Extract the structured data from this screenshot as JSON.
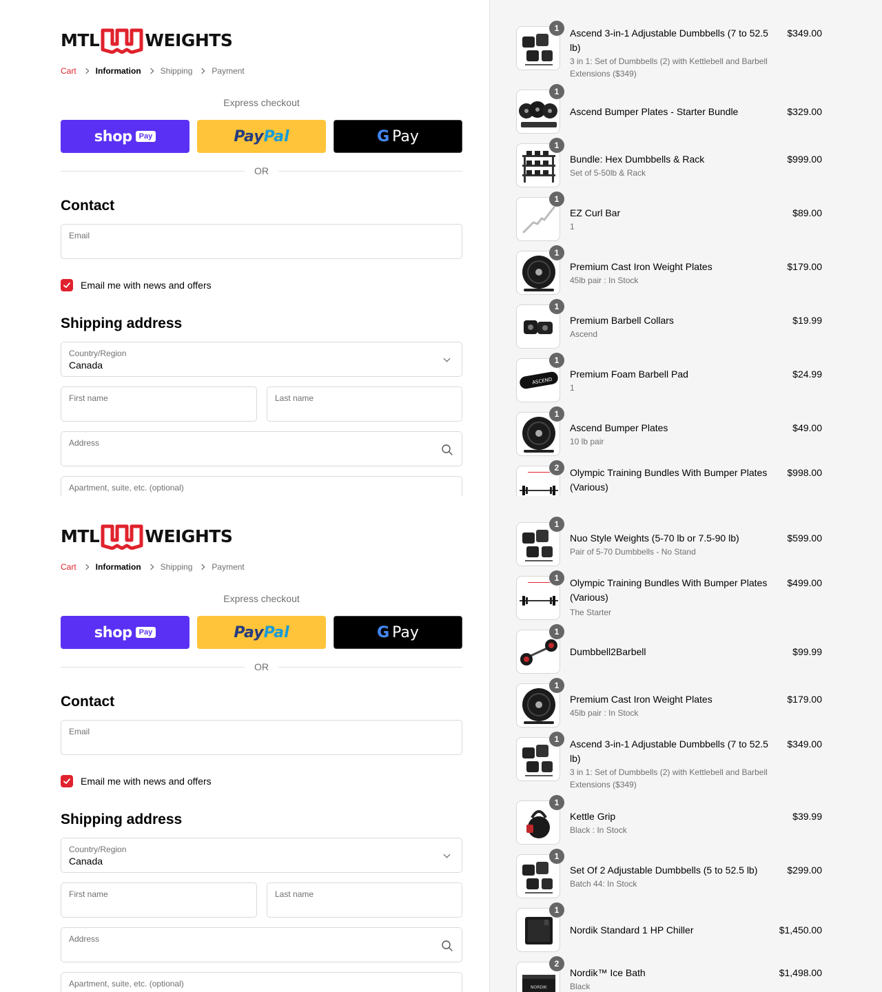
{
  "brand": {
    "logo_left": "MTL",
    "logo_right": "WEIGHTS",
    "accent": "#e0222c"
  },
  "breadcrumb": [
    "Cart",
    "Information",
    "Shipping",
    "Payment"
  ],
  "express": {
    "title": "Express checkout",
    "shop_pay": {
      "word": "shop",
      "badge": "Pay",
      "color": "#5a31f4"
    },
    "paypal": {
      "part1": "Pay",
      "part2": "Pal",
      "color": "#ffc439"
    },
    "gpay": {
      "g": "G",
      "word": "Pay"
    },
    "or": "OR"
  },
  "contact": {
    "title": "Contact",
    "email_label": "Email",
    "newsletter_label": "Email me with news and offers",
    "newsletter_checked": true
  },
  "shipping": {
    "title": "Shipping address",
    "country_label": "Country/Region",
    "country_value": "Canada",
    "first_name_label": "First name",
    "last_name_label": "Last name",
    "address_label": "Address",
    "apartment_label": "Apartment, suite, etc. (optional)"
  },
  "cart_top": [
    {
      "qty": "1",
      "name": "Ascend 3-in-1 Adjustable Dumbbells (7 to 52.5 lb)",
      "variant": "3 in 1: Set of Dumbbells (2) with Kettlebell and Barbell Extensions ($349)",
      "price": "$349.00",
      "icon": "adjustable-dumbbell-icon"
    },
    {
      "qty": "1",
      "name": "Ascend Bumper Plates - Starter Bundle",
      "variant": "",
      "price": "$329.00",
      "icon": "bumper-plates-icon"
    },
    {
      "qty": "1",
      "name": "Bundle: Hex Dumbbells & Rack",
      "variant": "Set of 5-50lb & Rack",
      "price": "$999.00",
      "icon": "dumbbell-rack-icon"
    },
    {
      "qty": "1",
      "name": "EZ Curl Bar",
      "variant": "1",
      "price": "$89.00",
      "icon": "curl-bar-icon"
    },
    {
      "qty": "1",
      "name": "Premium Cast Iron Weight Plates",
      "variant": "45lb pair : In Stock",
      "price": "$179.00",
      "icon": "weight-plate-icon"
    },
    {
      "qty": "1",
      "name": "Premium Barbell Collars",
      "variant": "Ascend",
      "price": "$19.99",
      "icon": "barbell-collar-icon"
    },
    {
      "qty": "1",
      "name": "Premium Foam Barbell Pad",
      "variant": "1",
      "price": "$24.99",
      "icon": "barbell-pad-icon"
    },
    {
      "qty": "1",
      "name": "Ascend Bumper Plates",
      "variant": "10 lb pair",
      "price": "$49.00",
      "icon": "weight-plate-icon"
    },
    {
      "qty": "2",
      "name": "Olympic Training Bundles With Bumper Plates (Various)",
      "variant": "",
      "price": "$998.00",
      "icon": "barbell-bundle-icon"
    }
  ],
  "cart_bottom": [
    {
      "qty": "1",
      "name": "Nuo Style Weights (5-70 lb or 7.5-90 lb)",
      "variant": "Pair of 5-70 Dumbbells - No Stand",
      "price": "$599.00",
      "icon": "adjustable-dumbbell-icon"
    },
    {
      "qty": "1",
      "name": "Olympic Training Bundles With Bumper Plates (Various)",
      "variant": "The Starter",
      "price": "$499.00",
      "icon": "barbell-bundle-icon"
    },
    {
      "qty": "1",
      "name": "Dumbbell2Barbell",
      "variant": "",
      "price": "$99.99",
      "icon": "dumbbell-barbell-icon"
    },
    {
      "qty": "1",
      "name": "Premium Cast Iron Weight Plates",
      "variant": "45lb pair : In Stock",
      "price": "$179.00",
      "icon": "weight-plate-icon"
    },
    {
      "qty": "1",
      "name": "Ascend 3-in-1 Adjustable Dumbbells (7 to 52.5 lb)",
      "variant": "3 in 1: Set of Dumbbells (2) with Kettlebell and Barbell Extensions ($349)",
      "price": "$349.00",
      "icon": "adjustable-dumbbell-icon"
    },
    {
      "qty": "1",
      "name": "Kettle Grip",
      "variant": "Black : In Stock",
      "price": "$39.99",
      "icon": "kettle-grip-icon"
    },
    {
      "qty": "1",
      "name": "Set Of 2 Adjustable Dumbbells (5 to 52.5 lb)",
      "variant": "Batch 44: In Stock",
      "price": "$299.00",
      "icon": "adjustable-dumbbell-icon"
    },
    {
      "qty": "1",
      "name": "Nordik Standard 1 HP Chiller",
      "variant": "",
      "price": "$1,450.00",
      "icon": "chiller-icon"
    },
    {
      "qty": "2",
      "name": "Nordik™ Ice Bath",
      "variant": "Black",
      "price": "$1,498.00",
      "icon": "ice-bath-icon"
    }
  ]
}
